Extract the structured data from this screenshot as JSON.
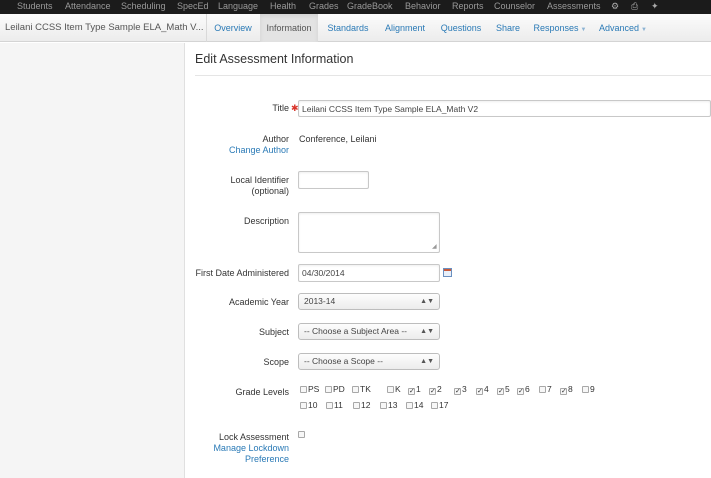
{
  "topnav": {
    "items": [
      "Students",
      "Attendance",
      "Scheduling",
      "SpecEd",
      "Language",
      "Health",
      "Grades",
      "GradeBook",
      "Behavior",
      "Reports",
      "Counselor",
      "Assessments"
    ],
    "icons": [
      "gear-icon",
      "print-icon",
      "wrench-icon"
    ]
  },
  "header": {
    "assessment_title": "Leilani CCSS Item Type Sample ELA_Math V...",
    "tabs": [
      {
        "label": "Overview",
        "active": false,
        "dropdown": false
      },
      {
        "label": "Information",
        "active": true,
        "dropdown": false
      },
      {
        "label": "Standards",
        "active": false,
        "dropdown": false
      },
      {
        "label": "Alignment",
        "active": false,
        "dropdown": false
      },
      {
        "label": "Questions",
        "active": false,
        "dropdown": false
      },
      {
        "label": "Share",
        "active": false,
        "dropdown": false
      },
      {
        "label": "Responses",
        "active": false,
        "dropdown": true
      },
      {
        "label": "Advanced",
        "active": false,
        "dropdown": true
      }
    ]
  },
  "form": {
    "heading": "Edit Assessment Information",
    "title_label": "Title",
    "title_value": "Leilani CCSS Item Type Sample ELA_Math V2",
    "author_label": "Author",
    "change_author": "Change Author",
    "author_value": "Conference, Leilani",
    "local_id_label": "Local Identifier",
    "local_id_sub": "(optional)",
    "local_id_value": "",
    "description_label": "Description",
    "description_value": "",
    "first_date_label": "First Date Administered",
    "first_date_value": "04/30/2014",
    "academic_year_label": "Academic Year",
    "academic_year_value": "2013-14",
    "subject_label": "Subject",
    "subject_value": "-- Choose a Subject Area --",
    "scope_label": "Scope",
    "scope_value": "-- Choose a Scope --",
    "grade_levels_label": "Grade Levels",
    "grades": [
      {
        "label": "PS",
        "checked": false
      },
      {
        "label": "PD",
        "checked": false
      },
      {
        "label": "TK",
        "checked": false
      },
      {
        "label": "K",
        "checked": false
      },
      {
        "label": "1",
        "checked": true
      },
      {
        "label": "2",
        "checked": true
      },
      {
        "label": "3",
        "checked": true
      },
      {
        "label": "4",
        "checked": true
      },
      {
        "label": "5",
        "checked": true
      },
      {
        "label": "6",
        "checked": true
      },
      {
        "label": "7",
        "checked": false
      },
      {
        "label": "8",
        "checked": true
      },
      {
        "label": "9",
        "checked": false
      },
      {
        "label": "10",
        "checked": false
      },
      {
        "label": "11",
        "checked": false
      },
      {
        "label": "12",
        "checked": false
      },
      {
        "label": "13",
        "checked": false
      },
      {
        "label": "14",
        "checked": false
      },
      {
        "label": "17",
        "checked": false
      }
    ],
    "lock_label": "Lock Assessment",
    "lock_checked": false,
    "manage_lockdown_1": "Manage Lockdown",
    "manage_lockdown_2": "Preference"
  },
  "colors": {
    "topnav_bg": "#1b1b1b",
    "link": "#2a7ab6",
    "required": "#d9342a"
  }
}
